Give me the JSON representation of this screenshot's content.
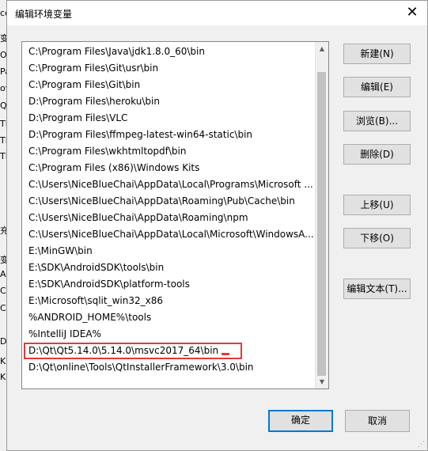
{
  "background_window": {
    "fragments": [
      "ce",
      "变",
      "O",
      "Pa",
      "ov",
      "Qs",
      "TE",
      "TE",
      "TN",
      "充",
      "变",
      "Al",
      "Cl",
      "Co",
      "Dr",
      "KI",
      "KI"
    ]
  },
  "dialog": {
    "title": "编辑环境变量",
    "close_glyph": "✕"
  },
  "path_list": {
    "items": [
      "C:\\Program Files\\Java\\jdk1.8.0_60\\bin",
      "C:\\Program Files\\Git\\usr\\bin",
      "C:\\Program Files\\Git\\bin",
      "D:\\Program Files\\heroku\\bin",
      "D:\\Program Files\\VLC",
      "D:\\Program Files\\ffmpeg-latest-win64-static\\bin",
      "C:\\Program Files\\wkhtmltopdf\\bin",
      "C:\\Program Files (x86)\\Windows Kits",
      "C:\\Users\\NiceBlueChai\\AppData\\Local\\Programs\\Microsoft ...",
      "C:\\Users\\NiceBlueChai\\AppData\\Roaming\\Pub\\Cache\\bin",
      "C:\\Users\\NiceBlueChai\\AppData\\Roaming\\npm",
      "C:\\Users\\NiceBlueChai\\AppData\\Local\\Microsoft\\WindowsA...",
      "E:\\MinGW\\bin",
      "E:\\SDK\\AndroidSDK\\tools\\bin",
      "E:\\SDK\\AndroidSDK\\platform-tools",
      "E:\\Microsoft\\sqlit_win32_x86",
      "%ANDROID_HOME%\\tools",
      "%IntelliJ IDEA%",
      "D:\\Qt\\Qt5.14.0\\5.14.0\\msvc2017_64\\bin",
      "D:\\Qt\\online\\Tools\\QtInstallerFramework\\3.0\\bin"
    ],
    "highlighted_index": 18,
    "scroll_up_glyph": "▲",
    "scroll_down_glyph": "▼"
  },
  "side_buttons": {
    "new": "新建(N)",
    "edit": "编辑(E)",
    "browse": "浏览(B)...",
    "delete": "删除(D)",
    "move_up": "上移(U)",
    "move_down": "下移(O)",
    "edit_text": "编辑文本(T)..."
  },
  "footer_buttons": {
    "ok": "确定",
    "cancel": "取消"
  },
  "colors": {
    "highlight_outline": "#e53935",
    "primary_focus": "#0078d7"
  }
}
